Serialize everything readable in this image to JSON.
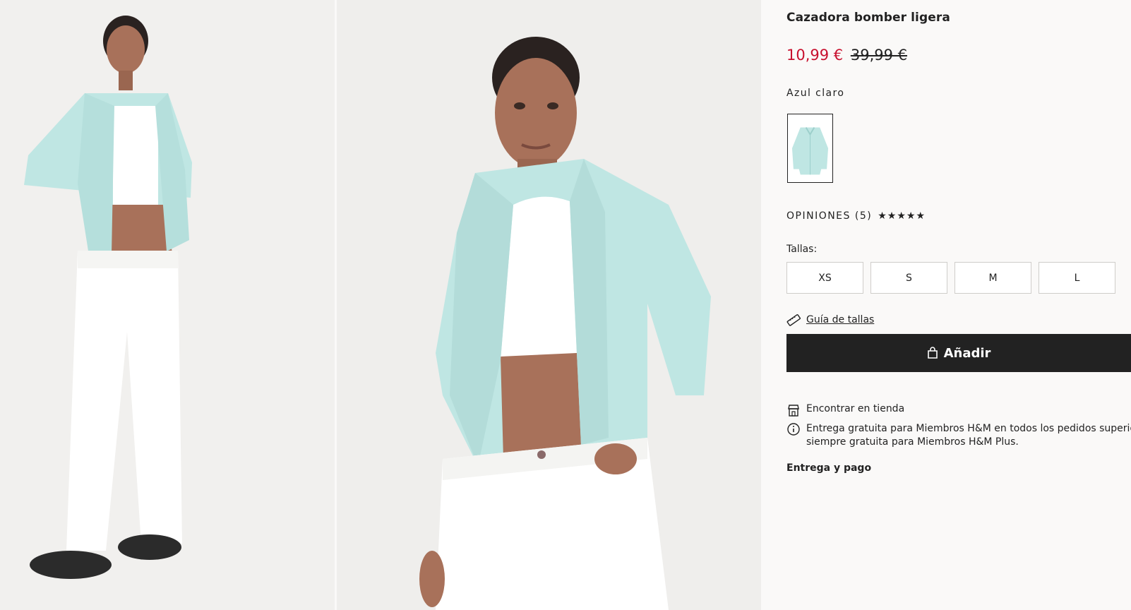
{
  "product": {
    "title": "Cazadora bomber ligera",
    "price_sale": "10,99 €",
    "price_original": "39,99 €",
    "color_name": "Azul claro"
  },
  "reviews": {
    "label": "OPINIONES (5)",
    "rating": 5
  },
  "sizes": {
    "label": "Tallas:",
    "options": [
      "XS",
      "S",
      "M",
      "L"
    ]
  },
  "size_guide_label": "Guía de tallas",
  "add_button_label": "Añadir",
  "store_label": "Encontrar en tienda",
  "delivery": {
    "line1": "Entrega gratuita para Miembros H&M en todos los pedidos superiores",
    "line2": "siempre gratuita para Miembros H&M Plus."
  },
  "payment_label": "Entrega y pago",
  "colors": {
    "sale": "#c8102e",
    "button": "#222222",
    "jacket": "#bfe6e3",
    "skin": "#a8715a"
  }
}
